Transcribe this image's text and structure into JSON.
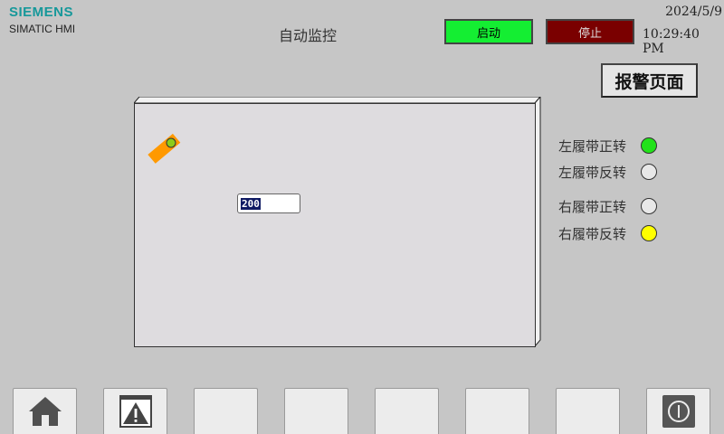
{
  "header": {
    "brand": "SIEMENS",
    "product": "SIMATIC HMI",
    "title": "自动监控",
    "start_label": "启动",
    "stop_label": "停止",
    "date": "2024/5/9",
    "time": "10:29:40 PM",
    "alarm_page_label": "报警页面"
  },
  "colors": {
    "start_button": "#14ee32",
    "stop_button": "#7a0000",
    "lamp_on_green": "#22e21a",
    "lamp_on_yellow": "#ffff00",
    "lamp_off": "#e8e8e8",
    "belt": "#ff9900"
  },
  "monitor": {
    "value": "200",
    "belt_icon": "conveyor-belt-icon",
    "sensor_lamp_color": "#8ccc1a"
  },
  "indicators": [
    {
      "label": "左履带正转",
      "state": "on",
      "color": "#22e21a"
    },
    {
      "label": "左履带反转",
      "state": "off",
      "color": "#e8e8e8"
    },
    {
      "label": "右履带正转",
      "state": "off",
      "color": "#e8e8e8"
    },
    {
      "label": "右履带反转",
      "state": "on",
      "color": "#ffff00"
    }
  ],
  "nav_buttons": [
    {
      "icon": "home-icon"
    },
    {
      "icon": "alarm-warning-icon"
    },
    {
      "icon": ""
    },
    {
      "icon": ""
    },
    {
      "icon": ""
    },
    {
      "icon": ""
    },
    {
      "icon": ""
    },
    {
      "icon": "power-icon"
    }
  ]
}
